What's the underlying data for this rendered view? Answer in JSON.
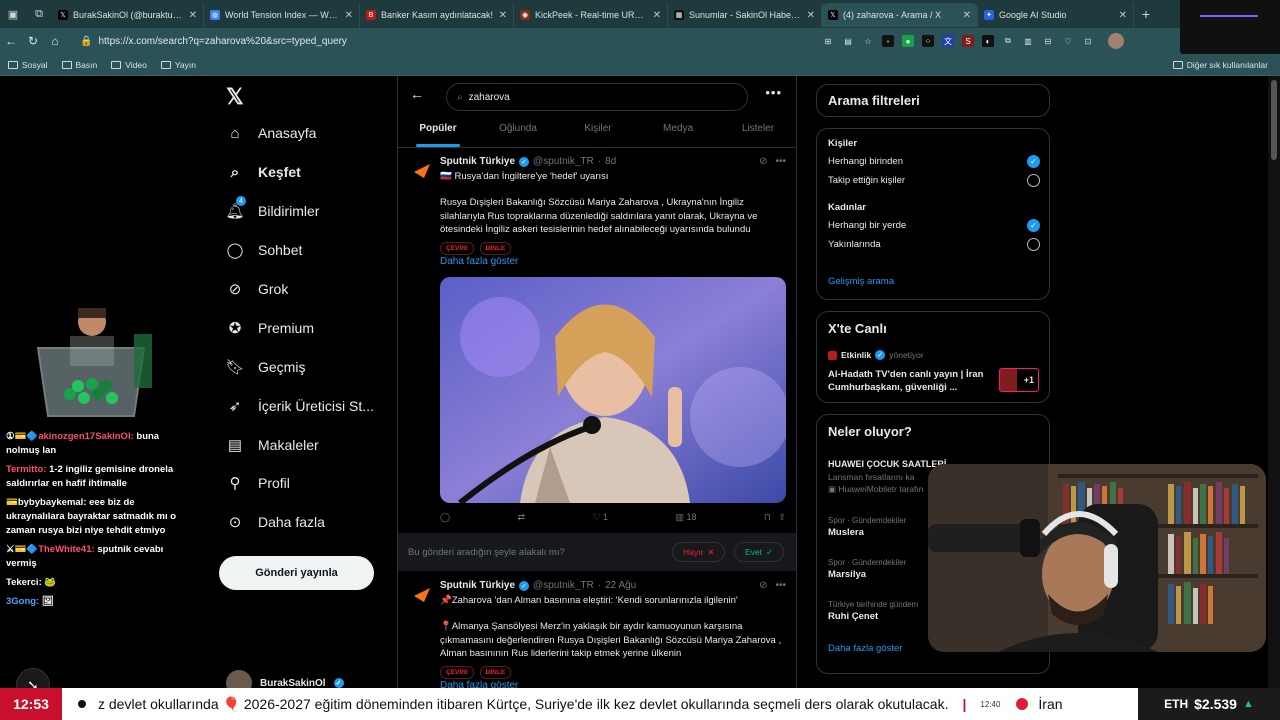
{
  "browser": {
    "tabs": [
      {
        "title": "BurakSakinOl (@buraktut_) / X",
        "favicon": "x-favicon",
        "color": "#000000"
      },
      {
        "title": "World Tension Index — World Te",
        "favicon": "globe-favicon",
        "color": "#3b82f6"
      },
      {
        "title": "Banker Kasım aydınlatacak!",
        "favicon": "b-favicon",
        "color": "#b91c1c"
      },
      {
        "title": "KickPeek - Real-time URL Crawler",
        "favicon": "kick-favicon",
        "color": "#7c2d12"
      },
      {
        "title": "Sunumlar - SakinOl Haber Merkez",
        "favicon": "tile-favicon",
        "color": "#111111"
      },
      {
        "title": "(4) zaharova - Arama / X",
        "favicon": "x-favicon",
        "color": "#000000",
        "active": true
      },
      {
        "title": "Google AI Studio",
        "favicon": "ai-favicon",
        "color": "#2563eb"
      }
    ],
    "url": "https://x.com/search?q=zaharova%20&src=typed_query",
    "bookmarks": [
      "Sosyal",
      "Basın",
      "Video",
      "Yayın"
    ],
    "other_bookmarks": "Diğer sık kullanılanlar"
  },
  "chat": [
    {
      "user": "akinozgen17SakinOl:",
      "user_color": "#ff4d6d",
      "badge": "①💳🔷",
      "text": "buna nolmuş lan"
    },
    {
      "user": "Termitto:",
      "user_color": "#ff4d6d",
      "badge": "",
      "text": "1-2 ingiliz gemisine dronela saldırırlar en hafif ihtimalle"
    },
    {
      "user": "bybybaykemal:",
      "user_color": "#ffffff",
      "badge": "💳",
      "text": "eee biz de ukraynalılara bayraktar satmadık mı o zaman rusya bizi niye tehdit etmiyo"
    },
    {
      "user": "TheWhite41:",
      "user_color": "#ff4d6d",
      "badge": "⚔💳🔷",
      "text": "sputnik cevabı vermiş"
    },
    {
      "user": "Tekerci:",
      "user_color": "#ffffff",
      "badge": "",
      "text": "🐸"
    },
    {
      "user": "3Gong:",
      "user_color": "#4da3ff",
      "badge": "",
      "text": "🖼"
    }
  ],
  "xnav": {
    "items": [
      "Anasayfa",
      "Keşfet",
      "Bildirimler",
      "Sohbet",
      "Grok",
      "Premium",
      "Geçmiş",
      "İçerik Üreticisi St...",
      "Makaleler",
      "Profil",
      "Daha fazla"
    ],
    "notif_count": "4",
    "post_button": "Gönderi yayınla",
    "profile_name": "BurakSakinOl"
  },
  "search": {
    "query": "zaharova",
    "tabs": [
      "Popüler",
      "Oğlunda",
      "Kişiler",
      "Medya",
      "Listeler"
    ]
  },
  "tweets": [
    {
      "name": "Sputnik Türkiye",
      "handle": "@sputnik_TR",
      "time": "8d",
      "headline": "🇷🇺 Rusya'dan İngiltere'ye 'hedef' uyarısı",
      "body": "Rusya Dışişleri Bakanlığı Sözcüsü Mariya  Zaharova , Ukrayna'nın İngiliz silahlarıyla Rus topraklarına düzenlediği saldırılara yanıt olarak, Ukrayna ve ötesindeki İngiliz askeri tesislerinin hedef alınabileceği uyarısında bulundu",
      "pills": [
        "ÇEVİRİ",
        "DİNLE"
      ],
      "more": "Daha fazla göster",
      "likes": "1",
      "views": "18"
    },
    {
      "name": "Sputnik Türkiye",
      "handle": "@sputnik_TR",
      "time": "22 Ağu",
      "headline": "📌Zaharova 'dan Alman basınına eleştiri: 'Kendi sorunlarınızla ilgilenin'",
      "body": "📍Almanya Şansölyesi Merz'in yaklaşık bir aydır kamuoyunun karşısına çıkmamasını değerlendiren Rusya Dışişleri Bakanlığı Sözcüsü Mariya Zaharova , Alman basınının Rus liderlerini takip etmek yerine ülkenin",
      "pills": [
        "ÇEVİRİ",
        "DİNLE"
      ],
      "more": "Daha fazla göster"
    }
  ],
  "relevance": {
    "question": "Bu gönderi aradığın şeyle alakalı mı?",
    "no": "Hayır",
    "yes": "Evet"
  },
  "filters": {
    "title": "Arama filtreleri",
    "people_label": "Kişiler",
    "people_opts": [
      "Herhangi birinden",
      "Takip ettiğin kişiler"
    ],
    "location_label": "Kadınlar",
    "location_opts": [
      "Herhangi bir yerde",
      "Yakınlarında"
    ],
    "advanced": "Gelişmiş arama"
  },
  "live": {
    "title": "X'te Canlı",
    "host": "Etkinlik",
    "host_role": "yönetiyor",
    "text": "Al-Hadath TV'den canlı yayın | İran Cumhurbaşkanı, güvenliği ...",
    "plus": "+1"
  },
  "trends": {
    "title": "Neler oluyor?",
    "promo_title": "HUAWEI ÇOCUK SAATLERİ",
    "promo_sub": "Lansman fırsatlarını ka",
    "promo_by": "HuaweiMobiletr tarafın",
    "items": [
      {
        "cat": "Spor · Gündemdekiler",
        "title": "Muslera"
      },
      {
        "cat": "Spor · Gündemdekiler",
        "title": "Marsilya"
      },
      {
        "cat": "Türkiye tarihinde gündem",
        "title": "Ruhi Çenet"
      }
    ],
    "more": "Daha fazla göster"
  },
  "ticker": {
    "time": "12:53",
    "text": "z devlet okullarında 🎈 2026-2027 eğitim döneminden itibaren Kürtçe, Suriye'de ilk kez devlet okullarında seçmeli ders olarak okutulacak.",
    "small_time": "12:40",
    "next": "İran",
    "coin": "ETH",
    "price": "$2.539"
  }
}
